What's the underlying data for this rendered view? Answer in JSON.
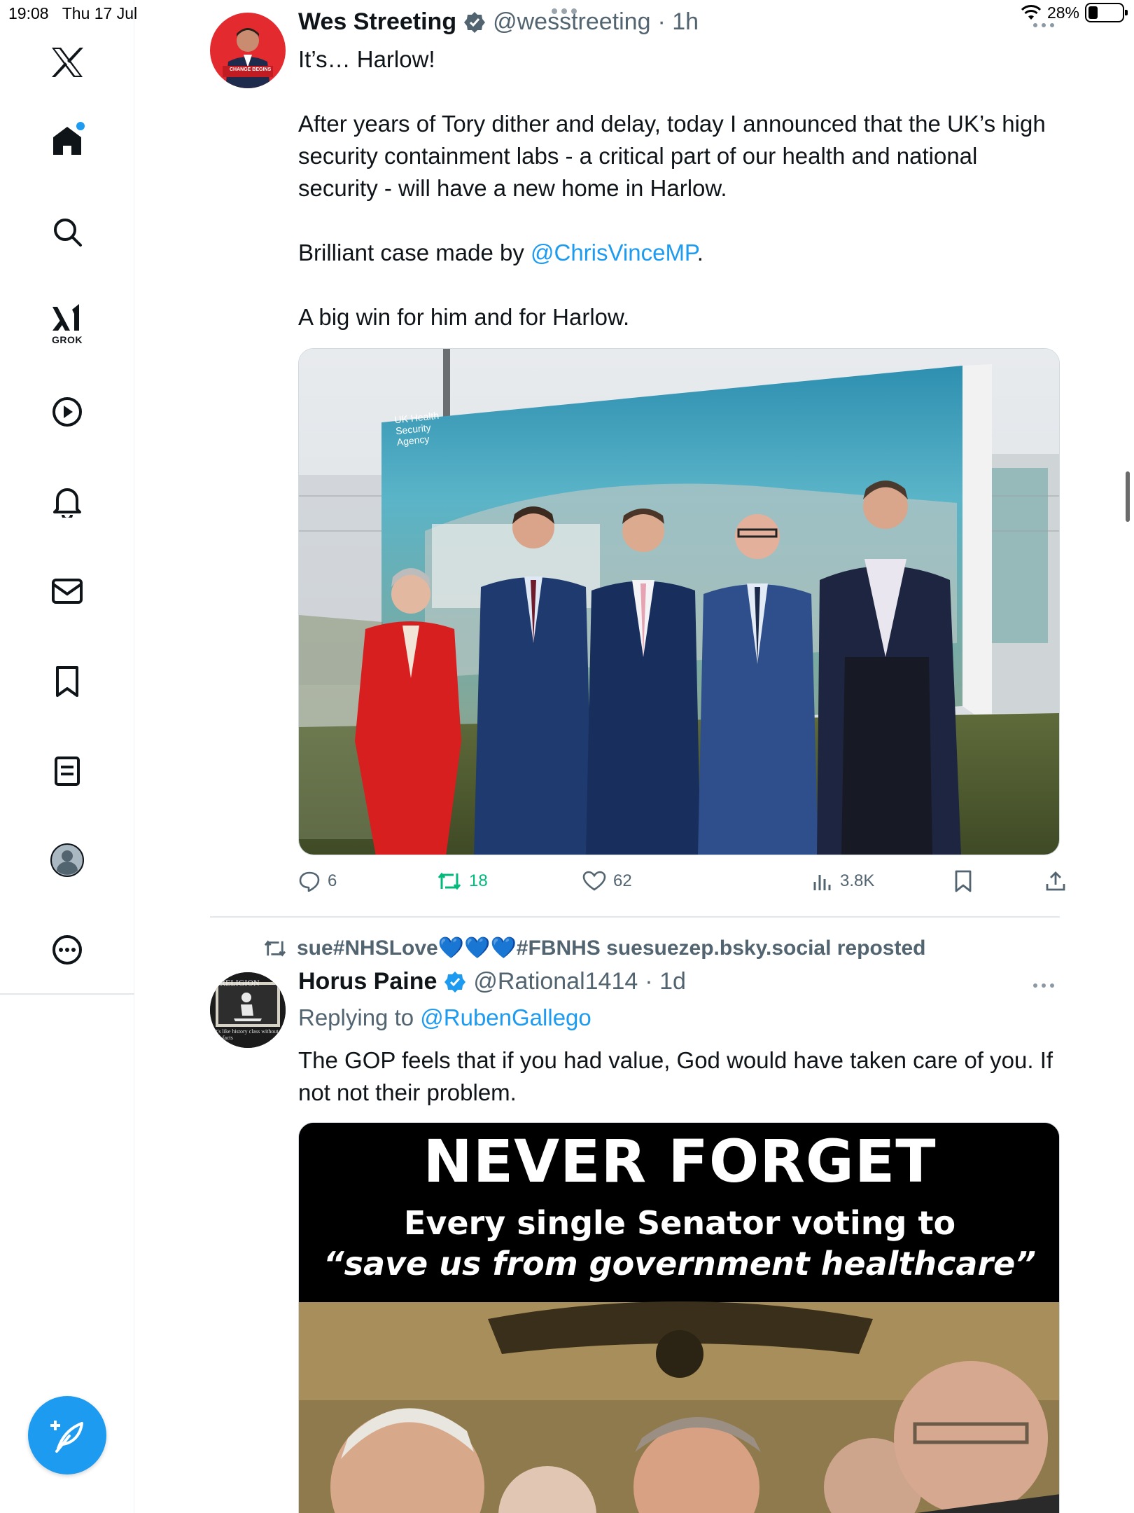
{
  "status_bar": {
    "time": "19:08",
    "date": "Thu 17 Jul",
    "battery": "28%",
    "battery_level": 0.28
  },
  "sidebar": {
    "items": [
      {
        "name": "x-logo",
        "icon": "x-logo-icon"
      },
      {
        "name": "home",
        "icon": "home-icon",
        "active": true,
        "notification_dot": true
      },
      {
        "name": "explore",
        "icon": "search-icon"
      },
      {
        "name": "grok",
        "icon": "grok-icon",
        "label": "GROK"
      },
      {
        "name": "videos",
        "icon": "play-icon"
      },
      {
        "name": "notifications",
        "icon": "bell-icon"
      },
      {
        "name": "messages",
        "icon": "mail-icon"
      },
      {
        "name": "bookmarks",
        "icon": "bookmark-icon"
      },
      {
        "name": "lists",
        "icon": "list-icon"
      },
      {
        "name": "profile",
        "icon": "profile-icon"
      },
      {
        "name": "more",
        "icon": "more-circle-icon"
      }
    ],
    "compose_icon": "compose-feather-icon",
    "accent": "#1d9bf0"
  },
  "tweets": [
    {
      "name": "Wes Streeting",
      "handle": "@wesstreeting",
      "time": "· 1h",
      "verified": true,
      "text": {
        "line1": "It’s… Harlow!",
        "para2": "After years of Tory dither and delay, today I announced that the UK’s high security containment labs - a critical part of our health and national security - will have a new home in Harlow.",
        "para3_prefix": "Brilliant case made by ",
        "para3_mention": "@ChrisVinceMP",
        "para3_suffix": ".",
        "para4": "A big win for him and for Harlow."
      },
      "media": {
        "billboard_text_1": "UK Health",
        "billboard_text_2": "Security",
        "billboard_text_3": "Agency"
      },
      "avatar_caption": "CHANGE BEGINS",
      "stats": {
        "replies": "6",
        "reposts": "18",
        "likes": "62",
        "views": "3.8K"
      }
    },
    {
      "repost_by": "sue#NHSLove💙💙💙#FBNHS suesuezep.bsky.social reposted",
      "name": "Horus Paine",
      "handle": "@Rational1414",
      "time": "· 1d",
      "verified": true,
      "replying_prefix": "Replying to ",
      "replying_to": "@RubenGallego",
      "text": "The GOP feels that if you had value, God would have taken care of you. If not not their problem.",
      "avatar_text_top": "RELIGION",
      "avatar_text_bottom": "It's like history class without the facts",
      "media": {
        "headline": "NEVER FORGET",
        "subline1": "Every single Senator voting to",
        "subline2": "“save us from government healthcare”"
      }
    }
  ],
  "colors": {
    "repost_green": "#00ba7c",
    "secondary_text": "#536471",
    "link_blue": "#1d9bf0"
  }
}
